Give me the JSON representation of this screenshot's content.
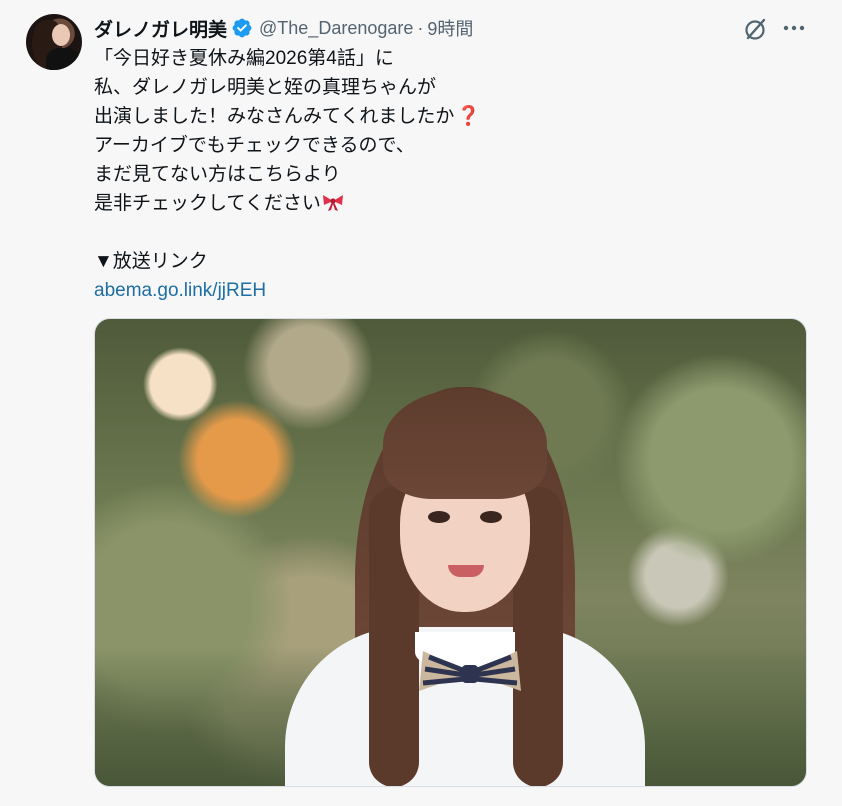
{
  "author": {
    "display_name": "ダレノガレ明美",
    "handle": "@The_Darenogare",
    "separator": "·",
    "time": "9時間",
    "verified_icon": "verified-badge-icon"
  },
  "actions": {
    "grok_icon": "grok-icon",
    "more_icon": "more-horizontal-icon"
  },
  "post": {
    "lines": [
      "「今日好き夏休み編2026第4話」に",
      "私、ダレノガレ明美と姪の真理ちゃんが",
      "出演しました！みなさんみてくれましたか",
      "アーカイブでもチェックできるので、",
      "まだ見てない方はこちらより",
      "是非チェックしてください"
    ],
    "question_emoji": "❓",
    "ribbon_emoji": "ribbon-icon",
    "link_heading": "▼放送リンク",
    "link_text": "abema.go.link/jjREH"
  },
  "media": {
    "type": "photo"
  },
  "colors": {
    "text": "#0f1419",
    "secondary": "#536471",
    "link": "#1d6ea3",
    "verified": "#1d9bf0",
    "background": "#f7f7f7"
  }
}
